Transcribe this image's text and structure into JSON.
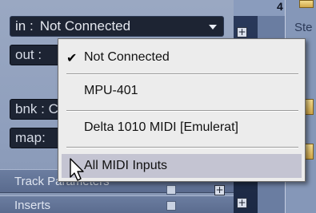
{
  "inspector": {
    "in_row": {
      "label": "in :",
      "value": "Not Connected"
    },
    "out_row": {
      "label": "out :"
    },
    "bnk_row": {
      "label": "bnk : C"
    },
    "map_row": {
      "label": "map:"
    },
    "sections": {
      "track_parameters": "Track Parameters",
      "inserts": "Inserts"
    }
  },
  "track_area": {
    "ruler_number": "4",
    "column_label": "Ste"
  },
  "menu": {
    "items": [
      {
        "label": "Not Connected",
        "checked": true
      },
      {
        "label": "MPU-401",
        "checked": false
      },
      {
        "label": "Delta 1010 MIDI [Emulerat]",
        "checked": false
      },
      {
        "label": "All MIDI Inputs",
        "checked": false,
        "highlighted": true
      }
    ],
    "check_glyph": "✔"
  },
  "colors": {
    "panel_bg": "#8f9fbd",
    "field_bg": "#1d2433",
    "menu_bg": "#ececec",
    "menu_highlight": "#c4c4d2",
    "accent_yellow": "#e6c46a"
  }
}
